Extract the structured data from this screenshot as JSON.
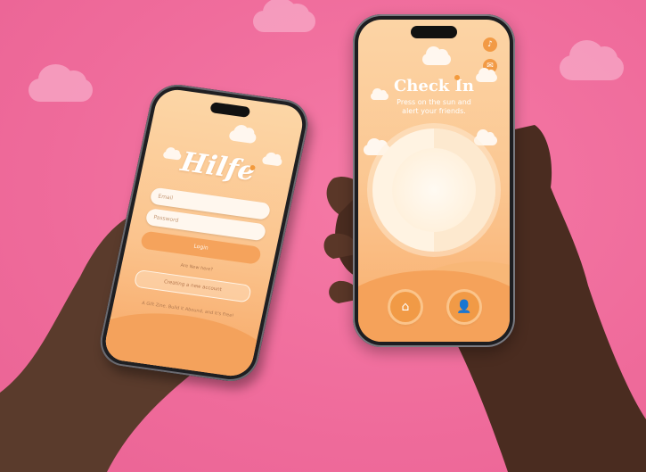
{
  "login_screen": {
    "logo": "Hilfe",
    "email_placeholder": "Email",
    "password_placeholder": "Password",
    "login_label": "Login",
    "new_prompt": "Are New here?",
    "create_label": "Creating a new account",
    "footer_text": "A Gift Zine. Build it Abound, and It's Free!"
  },
  "checkin_screen": {
    "title": "Check In",
    "subtitle_line1": "Press on the sun and",
    "subtitle_line2": "alert your friends.",
    "icons": {
      "sound": "speaker-icon",
      "share": "megaphone-icon",
      "home": "home-icon",
      "profile": "profile-icon"
    }
  },
  "colors": {
    "background": "#ef6b9b",
    "screen_gradient_top": "#fcd4a5",
    "accent_orange": "#f19a46"
  }
}
